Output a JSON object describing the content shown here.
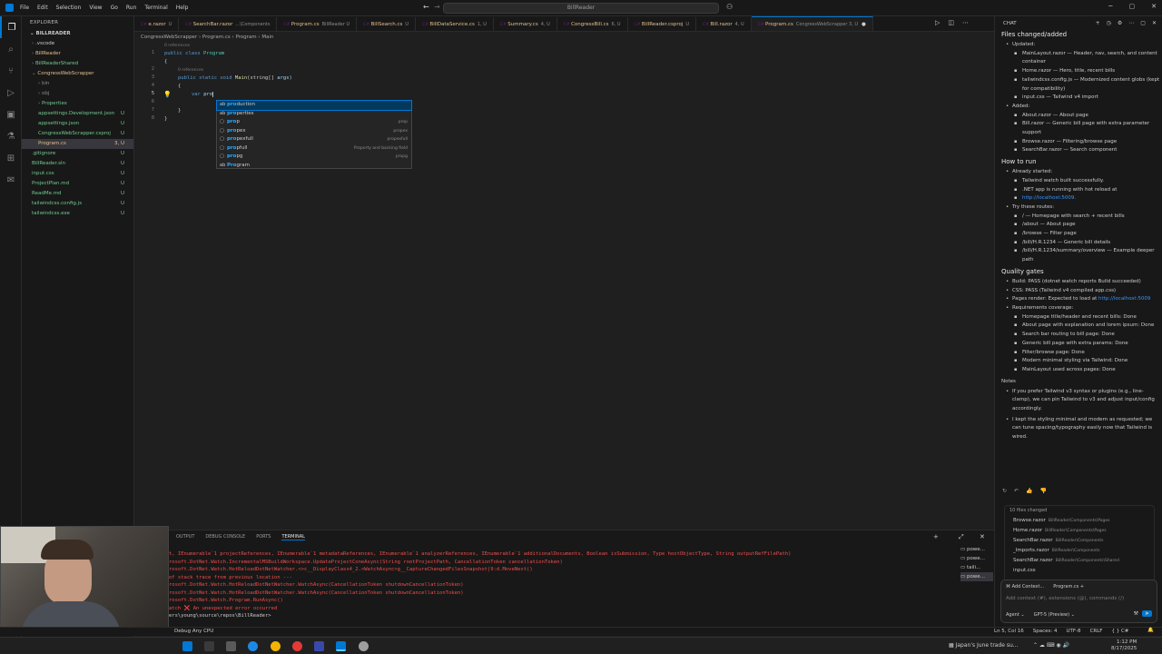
{
  "titlebar": {
    "menu": [
      "File",
      "Edit",
      "Selection",
      "View",
      "Go",
      "Run",
      "Terminal",
      "Help"
    ],
    "search": "BillReader"
  },
  "explorer": {
    "header": "EXPLORER",
    "root": "BILLREADER",
    "items": [
      {
        "label": ".vscode",
        "badge": "",
        "color": "#cccccc",
        "indent": 1,
        "chev": "›"
      },
      {
        "label": "BillReader",
        "badge": "",
        "color": "#e2c08d",
        "indent": 1,
        "chev": "›"
      },
      {
        "label": "BillReaderShared",
        "badge": "",
        "color": "#73c991",
        "indent": 1,
        "chev": "›"
      },
      {
        "label": "CongressWebScrapper",
        "badge": "",
        "color": "#e2c08d",
        "indent": 1,
        "chev": "⌄"
      },
      {
        "label": "bin",
        "badge": "",
        "color": "#8c8c8c",
        "indent": 2,
        "chev": "›"
      },
      {
        "label": "obj",
        "badge": "",
        "color": "#8c8c8c",
        "indent": 2,
        "chev": "›"
      },
      {
        "label": "Properties",
        "badge": "",
        "color": "#73c991",
        "indent": 2,
        "chev": "›"
      },
      {
        "label": "appsettings.Development.json",
        "badge": "U",
        "color": "#73c991",
        "indent": 2,
        "chev": ""
      },
      {
        "label": "appsettings.json",
        "badge": "U",
        "color": "#73c991",
        "indent": 2,
        "chev": ""
      },
      {
        "label": "CongressWebScrapper.csproj",
        "badge": "U",
        "color": "#73c991",
        "indent": 2,
        "chev": ""
      },
      {
        "label": "Program.cs",
        "badge": "3, U",
        "color": "#e2c08d",
        "indent": 2,
        "chev": "",
        "selected": true
      },
      {
        "label": ".gitignore",
        "badge": "U",
        "color": "#73c991",
        "indent": 1,
        "chev": ""
      },
      {
        "label": "BillReader.sln",
        "badge": "U",
        "color": "#73c991",
        "indent": 1,
        "chev": ""
      },
      {
        "label": "input.css",
        "badge": "U",
        "color": "#73c991",
        "indent": 1,
        "chev": ""
      },
      {
        "label": "ProjectPlan.md",
        "badge": "U",
        "color": "#73c991",
        "indent": 1,
        "chev": ""
      },
      {
        "label": "ReadMe.md",
        "badge": "U",
        "color": "#73c991",
        "indent": 1,
        "chev": ""
      },
      {
        "label": "tailwindcss.config.js",
        "badge": "U",
        "color": "#73c991",
        "indent": 1,
        "chev": ""
      },
      {
        "label": "tailwindcss.exe",
        "badge": "U",
        "color": "#73c991",
        "indent": 1,
        "chev": ""
      }
    ]
  },
  "tabs": [
    {
      "label": "e.razor",
      "sub": "U"
    },
    {
      "label": "SearchBar.razor",
      "sub": "...\\Components"
    },
    {
      "label": "Program.cs",
      "sub": "BillReader U"
    },
    {
      "label": "BillSearch.cs",
      "sub": "U"
    },
    {
      "label": "BillDataService.cs",
      "sub": "1, U"
    },
    {
      "label": "Summary.cs",
      "sub": "4, U"
    },
    {
      "label": "CongressBill.cs",
      "sub": "6, U"
    },
    {
      "label": "BillReader.csproj",
      "sub": "U"
    },
    {
      "label": "Bill.razor",
      "sub": "4, U"
    },
    {
      "label": "Program.cs",
      "sub": "CongressWebScrapper 3, U",
      "active": true
    }
  ],
  "breadcrumb": "CongressWebScrapper  ›  Program.cs  ›  Program  ›  Main",
  "editor": {
    "lines": [
      "1",
      "2",
      "3",
      "4",
      "5",
      "6",
      "7",
      "8"
    ],
    "refs1": "0 references",
    "refs2": "0 references",
    "code": {
      "l1_kw": "public class ",
      "l1_cls": "Program",
      "l2": "{",
      "l3_kw": "public static void ",
      "l3_fn": "Main",
      "l3_rest": "(string[] ",
      "l3_par": "args",
      "l3_end": ")",
      "l4": "{",
      "l5_kw": "var ",
      "l5_typed": "pro",
      "l6": "}",
      "l7": "}"
    }
  },
  "suggest": [
    {
      "icon": "ab",
      "match": "pro",
      "rest": "duction",
      "detail": "",
      "selected": true
    },
    {
      "icon": "ab",
      "match": "pro",
      "rest": "perties",
      "detail": ""
    },
    {
      "icon": "▢",
      "match": "pro",
      "rest": "p",
      "detail": "prop"
    },
    {
      "icon": "▢",
      "match": "pro",
      "rest": "pex",
      "detail": "propex"
    },
    {
      "icon": "▢",
      "match": "pro",
      "rest": "pexfull",
      "detail": "propexfull"
    },
    {
      "icon": "▢",
      "match": "pro",
      "rest": "pfull",
      "detail": "Property and backing field"
    },
    {
      "icon": "▢",
      "match": "pro",
      "rest": "pg",
      "detail": "propg"
    },
    {
      "icon": "ab",
      "match": "Pro",
      "rest": "gram",
      "detail": ""
    }
  ],
  "panel": {
    "tabs": [
      "OUTPUT",
      "DEBUG CONSOLE",
      "PORTS",
      "TERMINAL"
    ],
    "terminal_lines": [
      "t, IEnumerable`1 projectReferences, IEnumerable`1 metadataReferences, IEnumerable`1 analyzerReferences, IEnumerable`1 additionalDocuments, Boolean isSubmission, Type hostObjectType, String outputRefFilePath)",
      "rosoft.DotNet.Watch.IncrementalMSBuildWorkspace.UpdateProjectConeAsync(String rootProjectPath, CancellationToken cancellationToken)",
      "rosoft.DotNet.Watch.HotReloadDotNetWatcher.<>c__DisplayClass4_2.<WatchAsync>g__CaptureChangedFilesSnapshot|9:d.MoveNext()",
      "of stack trace from previous location ---",
      "rosoft.DotNet.Watch.HotReloadDotNetWatcher.WatchAsync(CancellationToken shutdownCancellationToken)",
      "rosoft.DotNet.Watch.HotReloadDotNetWatcher.WatchAsync(CancellationToken shutdownCancellationToken)",
      "rosoft.DotNet.Watch.Program.RunAsync()",
      "atch  ❌ An unexpected error occurred",
      "ers\\young\\source\\repos\\BillReader> "
    ],
    "terminals": [
      "powe...",
      "powe...",
      "taili...",
      "powe..."
    ]
  },
  "statusbar": {
    "left": "Debug Any CPU",
    "right": [
      "Ln 5, Col 16",
      "Spaces: 4",
      "UTF-8",
      "CRLF",
      "{ } C#"
    ]
  },
  "taskbar": {
    "news": "Japan's June trade su...",
    "time": "1:12 PM",
    "date": "8/17/2025"
  },
  "chat": {
    "header": "CHAT",
    "title_files": "Files changed/added",
    "updated_label": "Updated:",
    "updated": [
      "MainLayout.razor — Header, nav, search, and content container",
      "Home.razor — Hero, title, recent bills",
      "tailwindcss.config.js — Modernized content globs (kept for compatibility)",
      "input.css — Tailwind v4 import"
    ],
    "added_label": "Added:",
    "added": [
      "About.razor — About page",
      "Bill.razor — Generic bill page with extra parameter support",
      "Browse.razor — Filtering/browse page",
      "SearchBar.razor — Search component"
    ],
    "title_run": "How to run",
    "already_label": "Already started:",
    "already": [
      "Tailwind watch built successfully.",
      ".NET app is running with hot reload at"
    ],
    "localhost": "http://localhost:5009.",
    "routes_label": "Try these routes:",
    "routes": [
      "/ — Homepage with search + recent bills",
      "/about — About page",
      "/browse — Filter page",
      "/bill/H.R.1234 — Generic bill details",
      "/bill/H.R.1234/summary/overview — Example deeper path"
    ],
    "title_quality": "Quality gates",
    "quality": [
      "Build: PASS (dotnet watch reports Build succeeded)",
      "CSS: PASS (Tailwind v4 compiled app.css)",
      "Pages render: Expected to load at "
    ],
    "quality_link": "http://localhost:5009",
    "req_label": "Requirements coverage:",
    "reqs": [
      "Homepage title/header and recent bills: Done",
      "About page with explanation and lorem ipsum: Done",
      "Search bar routing to bill page: Done",
      "Generic bill page with extra params: Done",
      "Filter/browse page: Done",
      "Modern minimal styling via Tailwind: Done",
      "MainLayout used across pages: Done"
    ],
    "notes_label": "Notes",
    "notes": [
      "If you prefer Tailwind v3 syntax or plugins (e.g., line-clamp), we can pin Tailwind to v3 and adjust input/config accordingly.",
      "I kept the styling minimal and modern as requested; we can tune spacing/typography easily now that Tailwind is wired."
    ],
    "files_changed": "10 files changed",
    "changed_files": [
      {
        "name": "Browse.razor",
        "path": "BillReader\\Components\\Pages"
      },
      {
        "name": "Home.razor",
        "path": "BillReader\\Components\\Pages"
      },
      {
        "name": "SearchBar.razor",
        "path": "BillReader\\Components"
      },
      {
        "name": "_Imports.razor",
        "path": "BillReader\\Components"
      },
      {
        "name": "SearchBar.razor",
        "path": "BillReader\\Components\\Shared"
      },
      {
        "name": "input.css",
        "path": ""
      }
    ],
    "add_context": "Add Context...",
    "context_file": "Program.cs",
    "input_placeholder": "Add context (#), extensions (@), commands (/)",
    "mode": "Agent",
    "model": "GPT-5 (Preview)"
  },
  "colors": {
    "accent": "#0078d4",
    "untracked": "#73c991",
    "modified": "#e2c08d",
    "error": "#f14c4c"
  }
}
